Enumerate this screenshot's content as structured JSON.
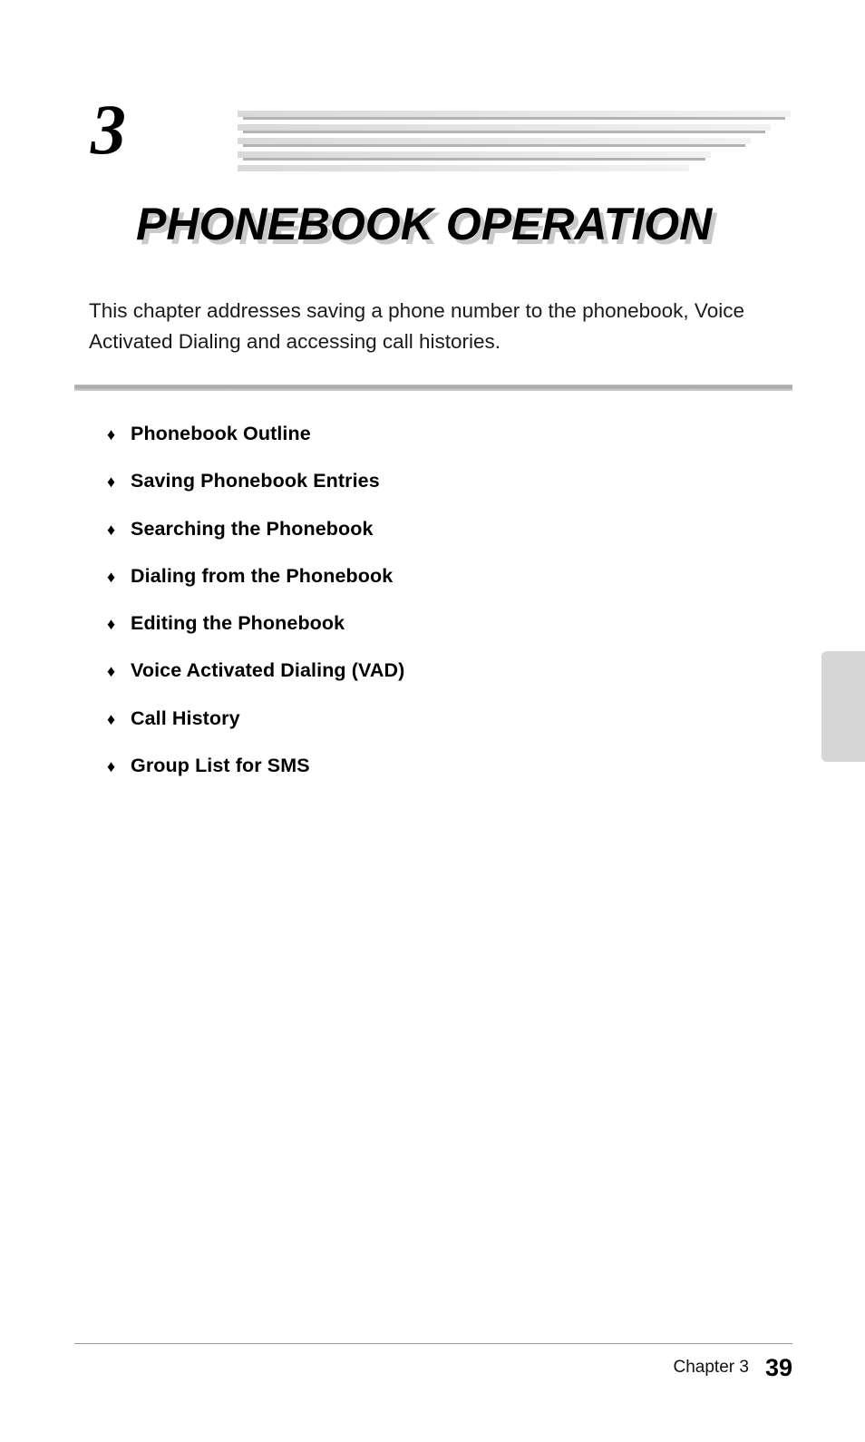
{
  "document": {
    "chapter_number": "3",
    "title": "PHONEBOOK OPERATION",
    "intro": "This chapter addresses saving a phone number to the phonebook, Voice Activated Dialing and accessing call histories.",
    "bullet_glyph": "♦",
    "contents": [
      {
        "label": "Phonebook Outline"
      },
      {
        "label": "Saving Phonebook Entries"
      },
      {
        "label": "Searching the Phonebook"
      },
      {
        "label": "Dialing from the Phonebook"
      },
      {
        "label": "Editing the Phonebook"
      },
      {
        "label": "Voice Activated Dialing (VAD)"
      },
      {
        "label": "Call History"
      },
      {
        "label": "Group List for SMS"
      }
    ],
    "footer": {
      "chapter_text": "Chapter 3",
      "page_number": "39"
    },
    "colors": {
      "text": "#000000",
      "title_shadow": "#c9c9c9",
      "rule": "#a6a6a6",
      "thumb_tab": "#d6d6d6",
      "stripe_light": "#e6e6e6",
      "stripe_dark": "#b3b3b3"
    }
  }
}
